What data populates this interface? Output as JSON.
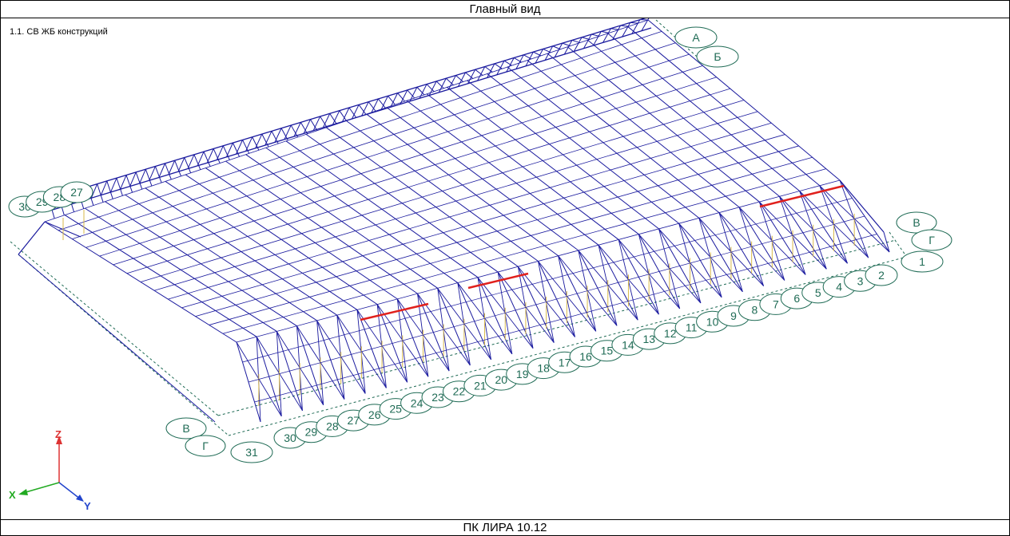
{
  "window": {
    "title": "Главный вид",
    "footer": "ПК ЛИРА 10.12"
  },
  "viewport": {
    "load_case": "1.1. СВ ЖБ конструкций"
  },
  "axes": {
    "x": "X",
    "y": "Y",
    "z": "Z"
  },
  "grid_labels": {
    "top_letters": [
      "А",
      "Б"
    ],
    "right_letters": [
      "В",
      "Г"
    ],
    "left_letters": [
      "В",
      "Г"
    ],
    "right_end_number": "1",
    "left_end_number": "31",
    "front_numbers": [
      "30",
      "29",
      "28",
      "27",
      "26",
      "25",
      "24",
      "23",
      "22",
      "21",
      "20",
      "19",
      "18",
      "17",
      "16",
      "15",
      "14",
      "13",
      "12",
      "11",
      "10",
      "9",
      "8",
      "7",
      "6",
      "5",
      "4",
      "3",
      "2"
    ],
    "back_numbers": [
      "30",
      "29",
      "28",
      "27"
    ]
  },
  "colors": {
    "members": "#1a1a9e",
    "struts": "#d8b94a",
    "highlight": "#e0201c",
    "grid": "#1f6b55",
    "axis_x": "#22aa22",
    "axis_y": "#2244cc",
    "axis_z": "#dd3333"
  }
}
